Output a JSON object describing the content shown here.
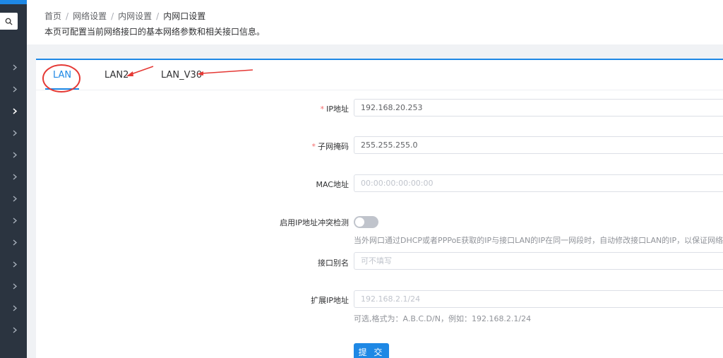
{
  "breadcrumb": {
    "items": [
      "首页",
      "网络设置",
      "内网设置"
    ],
    "current": "内网口设置",
    "separator": "/"
  },
  "page": {
    "description": "本页可配置当前网络接口的基本网络参数和相关接口信息。"
  },
  "tabs": [
    {
      "label": "LAN",
      "active": true
    },
    {
      "label": "LAN2",
      "active": false
    },
    {
      "label": "LAN_V30",
      "active": false
    }
  ],
  "form": {
    "ip": {
      "required_mark": "*",
      "label": "IP地址",
      "value": "192.168.20.253"
    },
    "netmask": {
      "required_mark": "*",
      "label": "子网掩码",
      "value": "255.255.255.0"
    },
    "mac": {
      "label": "MAC地址",
      "placeholder": "00:00:00:00:00:00"
    },
    "ip_conflict": {
      "label": "启用IP地址冲突检测",
      "enabled": false,
      "hint": "当外网口通过DHCP或者PPPoE获取的IP与接口LAN的IP在同一网段时，自动修改接口LAN的IP，以保证网络畅通"
    },
    "alias": {
      "label": "接口别名",
      "placeholder": "可不填写"
    },
    "ext_ip": {
      "label": "扩展IP地址",
      "placeholder": "192.168.2.1/24",
      "hint": "可选,格式为：A.B.C.D/N，例如：192.168.2.1/24"
    },
    "submit_label": "提 交"
  },
  "colors": {
    "accent": "#1e88e5",
    "sidebar_bg": "#2b3440",
    "annotation": "#e53935",
    "required": "#f56c6c"
  },
  "icons": {
    "search": "search-icon",
    "sidebar_expand": "chevron-right-icon"
  }
}
